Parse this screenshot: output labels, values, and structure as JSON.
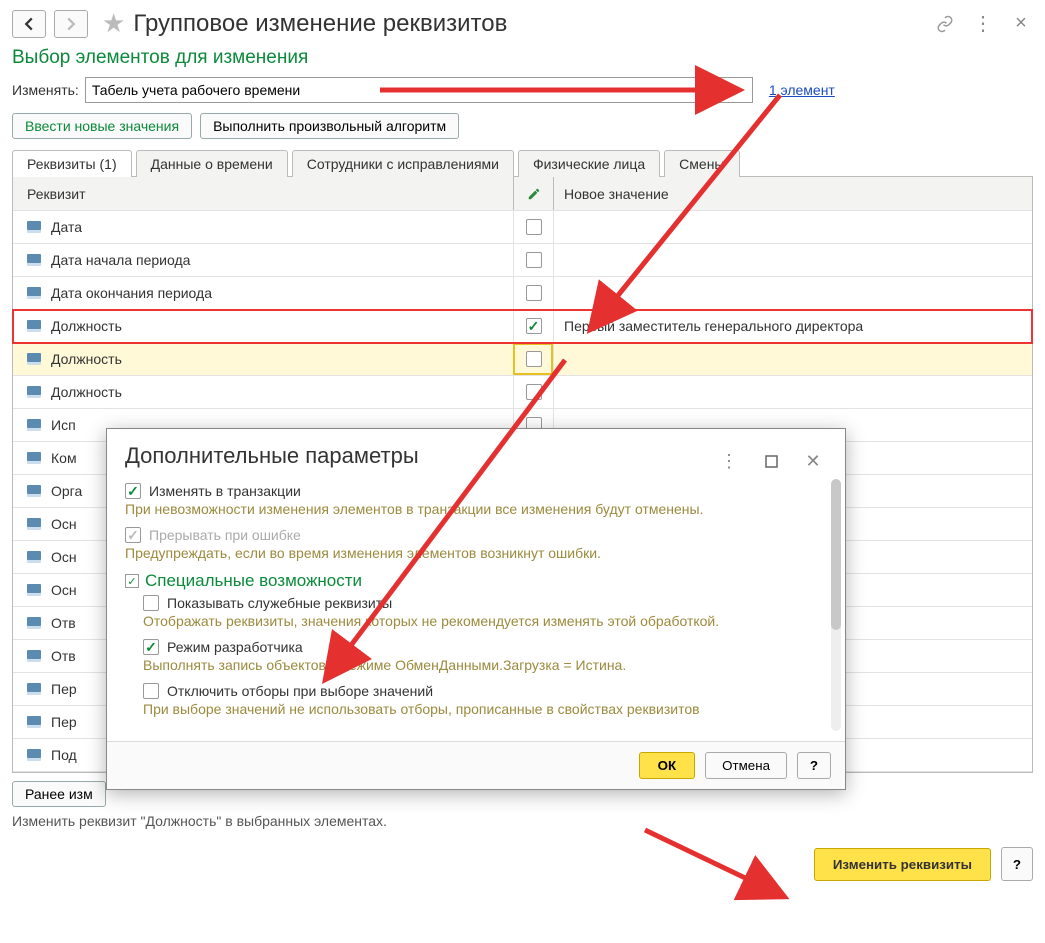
{
  "header": {
    "title": "Групповое изменение реквизитов",
    "subtitle": "Выбор элементов для изменения",
    "change_label": "Изменять:",
    "change_value": "Табель учета рабочего времени",
    "elements_link": "1 элемент"
  },
  "buttons": {
    "enter_values": "Ввести новые значения",
    "run_algorithm": "Выполнить произвольный алгоритм",
    "earlier": "Ранее изм",
    "main_action": "Изменить реквизиты",
    "help": "?"
  },
  "tabs": [
    "Реквизиты (1)",
    "Данные о времени",
    "Сотрудники с исправлениями",
    "Физические лица",
    "Смены"
  ],
  "grid": {
    "col_req": "Реквизит",
    "col_val": "Новое значение",
    "rows": [
      {
        "name": "Дата",
        "chk": false,
        "val": ""
      },
      {
        "name": "Дата начала периода",
        "chk": false,
        "val": ""
      },
      {
        "name": "Дата окончания периода",
        "chk": false,
        "val": ""
      },
      {
        "name": "Должность",
        "chk": true,
        "val": "Первый заместитель генерального директора",
        "hl": "red"
      },
      {
        "name": "Должность",
        "chk": false,
        "val": "",
        "hl": "gold"
      },
      {
        "name": "Должность",
        "chk": false,
        "val": ""
      },
      {
        "name": "Исп",
        "chk": false,
        "val": ""
      },
      {
        "name": "Ком",
        "chk": false,
        "val": ""
      },
      {
        "name": "Орга",
        "chk": false,
        "val": ""
      },
      {
        "name": "Осн",
        "chk": false,
        "val": ""
      },
      {
        "name": "Осн",
        "chk": false,
        "val": ""
      },
      {
        "name": "Осн",
        "chk": false,
        "val": ""
      },
      {
        "name": "Отв",
        "chk": false,
        "val": ""
      },
      {
        "name": "Отв",
        "chk": false,
        "val": ""
      },
      {
        "name": "Пер",
        "chk": false,
        "val": ""
      },
      {
        "name": "Пер",
        "chk": false,
        "val": ""
      },
      {
        "name": "Под",
        "chk": false,
        "val": ""
      }
    ]
  },
  "status": "Изменить реквизит \"Должность\" в выбранных элементах.",
  "modal": {
    "title": "Дополнительные параметры",
    "chk1": "Изменять в транзакции",
    "hint1": "При невозможности изменения элементов в транзакции все изменения будут отменены.",
    "chk2": "Прерывать при ошибке",
    "hint2": "Предупреждать, если во время изменения элементов возникнут ошибки.",
    "section": "Специальные возможности",
    "chk3": "Показывать служебные реквизиты",
    "hint3": "Отображать реквизиты, значения которых не рекомендуется изменять этой обработкой.",
    "chk4": "Режим разработчика",
    "hint4": "Выполнять запись объектов в режиме ОбменДанными.Загрузка = Истина.",
    "chk5": "Отключить отборы при выборе значений",
    "hint5": "При выборе значений не использовать отборы, прописанные в свойствах реквизитов",
    "ok": "ОК",
    "cancel": "Отмена",
    "help": "?"
  }
}
